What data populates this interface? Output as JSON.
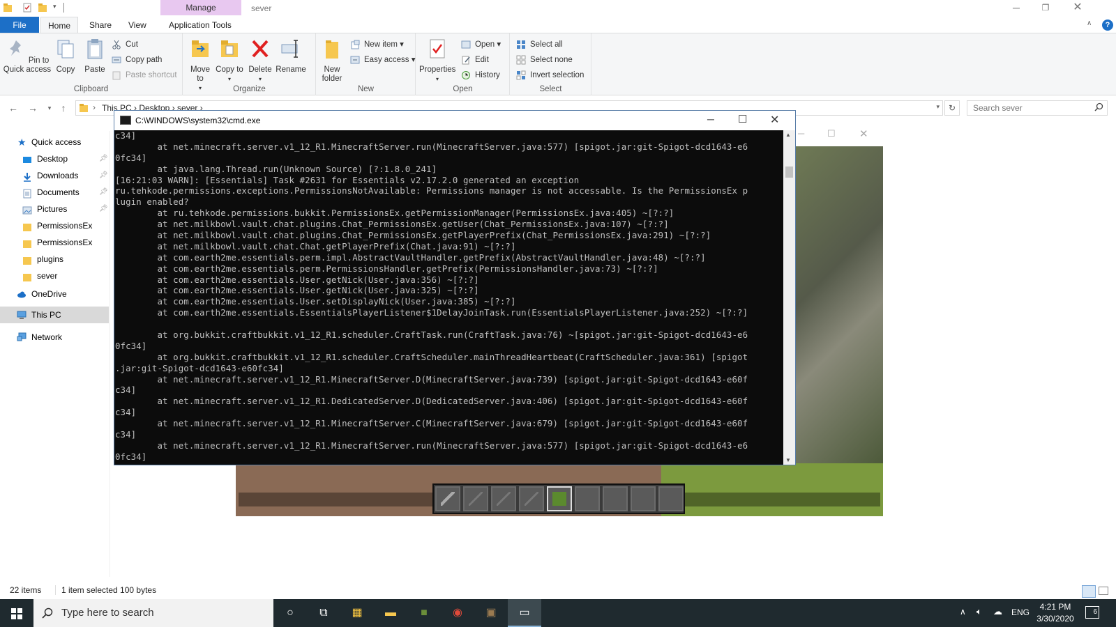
{
  "titlebar": {
    "manage_tab": "Manage",
    "window_title": "sever"
  },
  "ribbon_tabs": {
    "file": "File",
    "home": "Home",
    "share": "Share",
    "view": "View",
    "app_tools": "Application Tools"
  },
  "ribbon": {
    "clipboard": {
      "label": "Clipboard",
      "pin": "Pin to Quick access",
      "copy": "Copy",
      "paste": "Paste",
      "cut": "Cut",
      "copy_path": "Copy path",
      "paste_shortcut": "Paste shortcut"
    },
    "organize": {
      "label": "Organize",
      "move_to": "Move to",
      "copy_to": "Copy to",
      "delete": "Delete",
      "rename": "Rename"
    },
    "new": {
      "label": "New",
      "new_folder": "New folder",
      "new_item": "New item",
      "easy_access": "Easy access"
    },
    "open": {
      "label": "Open",
      "properties": "Properties",
      "open": "Open",
      "edit": "Edit",
      "history": "History"
    },
    "select": {
      "label": "Select",
      "select_all": "Select all",
      "select_none": "Select none",
      "invert": "Invert selection"
    }
  },
  "address": {
    "crumbs": "This PC  ›  Desktop  ›  sever  ›",
    "search_placeholder": "Search sever"
  },
  "nav": {
    "quick_access": "Quick access",
    "items": [
      {
        "label": "Desktop",
        "icon": "desktop-icon",
        "pinned": true
      },
      {
        "label": "Downloads",
        "icon": "downloads-icon",
        "pinned": true
      },
      {
        "label": "Documents",
        "icon": "documents-icon",
        "pinned": true
      },
      {
        "label": "Pictures",
        "icon": "pictures-icon",
        "pinned": true
      },
      {
        "label": "PermissionsEx",
        "icon": "folder-icon",
        "pinned": false
      },
      {
        "label": "PermissionsEx",
        "icon": "folder-icon",
        "pinned": false
      },
      {
        "label": "plugins",
        "icon": "folder-icon",
        "pinned": false
      },
      {
        "label": "sever",
        "icon": "folder-icon",
        "pinned": false
      }
    ],
    "onedrive": "OneDrive",
    "this_pc": "This PC",
    "network": "Network"
  },
  "status": {
    "items": "22 items",
    "selected": "1 item selected  100 bytes"
  },
  "cmd": {
    "title": "C:\\WINDOWS\\system32\\cmd.exe",
    "lines": [
      "c34]",
      "        at net.minecraft.server.v1_12_R1.MinecraftServer.run(MinecraftServer.java:577) [spigot.jar:git-Spigot-dcd1643-e6",
      "0fc34]",
      "        at java.lang.Thread.run(Unknown Source) [?:1.8.0_241]",
      "[16:21:03 WARN]: [Essentials] Task #2631 for Essentials v2.17.2.0 generated an exception",
      "ru.tehkode.permissions.exceptions.PermissionsNotAvailable: Permissions manager is not accessable. Is the PermissionsEx p",
      "lugin enabled?",
      "        at ru.tehkode.permissions.bukkit.PermissionsEx.getPermissionManager(PermissionsEx.java:405) ~[?:?]",
      "        at net.milkbowl.vault.chat.plugins.Chat_PermissionsEx.getUser(Chat_PermissionsEx.java:107) ~[?:?]",
      "        at net.milkbowl.vault.chat.plugins.Chat_PermissionsEx.getPlayerPrefix(Chat_PermissionsEx.java:291) ~[?:?]",
      "        at net.milkbowl.vault.chat.Chat.getPlayerPrefix(Chat.java:91) ~[?:?]",
      "        at com.earth2me.essentials.perm.impl.AbstractVaultHandler.getPrefix(AbstractVaultHandler.java:48) ~[?:?]",
      "        at com.earth2me.essentials.perm.PermissionsHandler.getPrefix(PermissionsHandler.java:73) ~[?:?]",
      "        at com.earth2me.essentials.User.getNick(User.java:356) ~[?:?]",
      "        at com.earth2me.essentials.User.getNick(User.java:325) ~[?:?]",
      "        at com.earth2me.essentials.User.setDisplayNick(User.java:385) ~[?:?]",
      "        at com.earth2me.essentials.EssentialsPlayerListener$1DelayJoinTask.run(EssentialsPlayerListener.java:252) ~[?:?]",
      "",
      "        at org.bukkit.craftbukkit.v1_12_R1.scheduler.CraftTask.run(CraftTask.java:76) ~[spigot.jar:git-Spigot-dcd1643-e6",
      "0fc34]",
      "        at org.bukkit.craftbukkit.v1_12_R1.scheduler.CraftScheduler.mainThreadHeartbeat(CraftScheduler.java:361) [spigot",
      ".jar:git-Spigot-dcd1643-e60fc34]",
      "        at net.minecraft.server.v1_12_R1.MinecraftServer.D(MinecraftServer.java:739) [spigot.jar:git-Spigot-dcd1643-e60f",
      "c34]",
      "        at net.minecraft.server.v1_12_R1.DedicatedServer.D(DedicatedServer.java:406) [spigot.jar:git-Spigot-dcd1643-e60f",
      "c34]",
      "        at net.minecraft.server.v1_12_R1.MinecraftServer.C(MinecraftServer.java:679) [spigot.jar:git-Spigot-dcd1643-e60f",
      "c34]",
      "        at net.minecraft.server.v1_12_R1.MinecraftServer.run(MinecraftServer.java:577) [spigot.jar:git-Spigot-dcd1643-e6",
      "0fc34]"
    ]
  },
  "taskbar": {
    "search_placeholder": "Type here to search",
    "lang": "ENG",
    "time": "4:21 PM",
    "date": "3/30/2020",
    "notifications": "6"
  },
  "colors": {
    "accent": "#1c6fc7",
    "manage_tab": "#e8c8f0",
    "console_bg": "#0c0c0c",
    "console_fg": "#c0c0c0",
    "taskbar": "#1f2a2f"
  }
}
